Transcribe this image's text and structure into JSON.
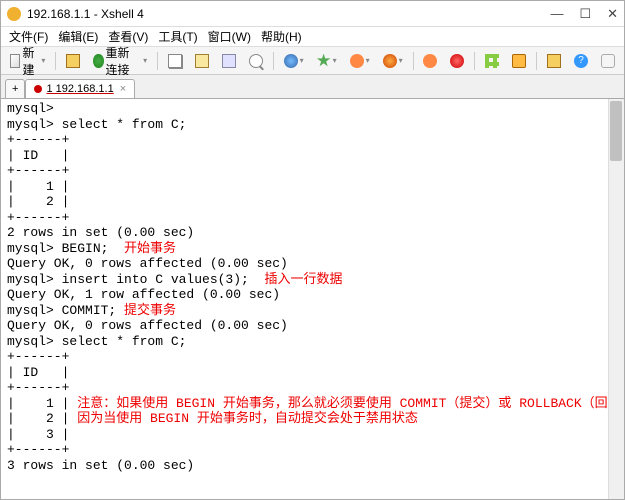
{
  "titlebar": {
    "title": "192.168.1.1 - Xshell 4"
  },
  "menubar": {
    "file": "文件(F)",
    "edit": "编辑(E)",
    "view": "查看(V)",
    "tools": "工具(T)",
    "window": "窗口(W)",
    "help": "帮助(H)"
  },
  "toolbar": {
    "new_label": "新建",
    "reconnect_label": "重新连接"
  },
  "tabs": {
    "add": "+",
    "active": "1 192.168.1.1"
  },
  "terminal": {
    "lines": [
      {
        "t": "mysql>"
      },
      {
        "t": "mysql> select * from C;"
      },
      {
        "t": "+------+"
      },
      {
        "t": "| ID   |"
      },
      {
        "t": "+------+"
      },
      {
        "t": "|    1 |"
      },
      {
        "t": "|    2 |"
      },
      {
        "t": "+------+"
      },
      {
        "t": "2 rows in set (0.00 sec)"
      },
      {
        "t": ""
      },
      {
        "t": "mysql> BEGIN;  ",
        "r": "开始事务"
      },
      {
        "t": "Query OK, 0 rows affected (0.00 sec)"
      },
      {
        "t": ""
      },
      {
        "t": "mysql> insert into C values(3);  ",
        "r": "插入一行数据"
      },
      {
        "t": "Query OK, 1 row affected (0.00 sec)"
      },
      {
        "t": ""
      },
      {
        "t": "mysql> COMMIT; ",
        "r": "提交事务"
      },
      {
        "t": "Query OK, 0 rows affected (0.00 sec)"
      },
      {
        "t": ""
      },
      {
        "t": "mysql> select * from C;"
      },
      {
        "t": "+------+"
      },
      {
        "t": "| ID   |"
      },
      {
        "t": "+------+"
      },
      {
        "t": "|    1 | ",
        "r": "注意：如果使用 BEGIN 开始事务，那么就必须要使用 COMMIT（提交）或 ROLLBACK（回滚），"
      },
      {
        "t": "|    2 | ",
        "r": "因为当使用 BEGIN 开始事务时，自动提交会处于禁用状态"
      },
      {
        "t": "|    3 |"
      },
      {
        "t": "+------+"
      },
      {
        "t": "3 rows in set (0.00 sec)"
      }
    ]
  }
}
